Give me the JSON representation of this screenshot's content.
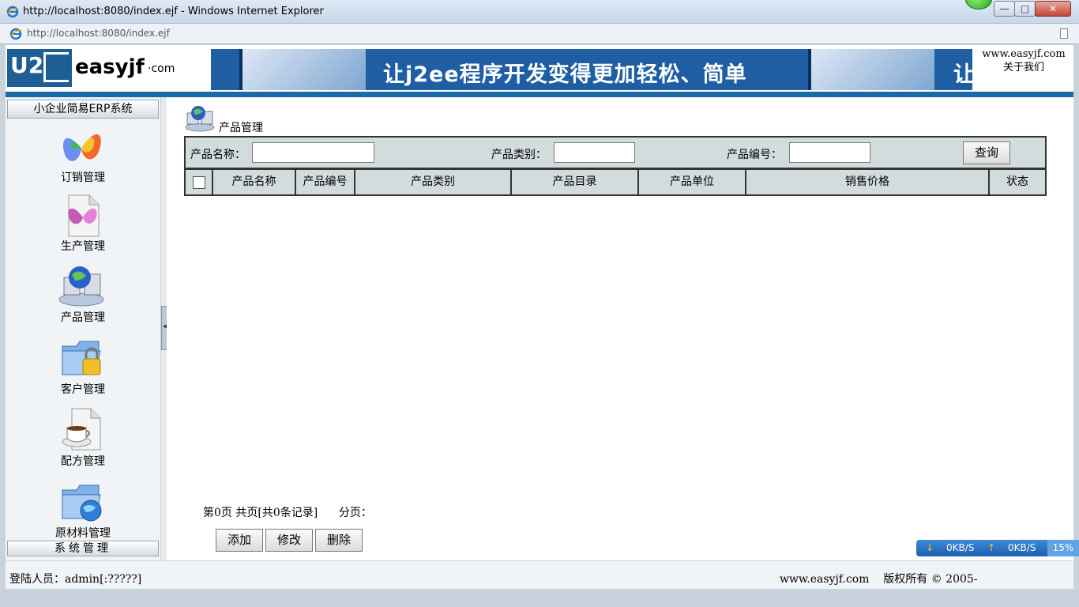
{
  "window": {
    "title": "http://localhost:8080/index.ejf - Windows Internet Explorer",
    "address": "http://localhost:8080/index.ejf",
    "min_glyph": "—",
    "max_glyph": "□",
    "close_glyph": "✕"
  },
  "header": {
    "logo_mark": "U2",
    "logo_text": "easyjf",
    "logo_suffix": "·com",
    "banner_slogan": "让j2ee程序开发变得更加轻松、简单",
    "banner_slogan_repeat": "让",
    "site": "www.easyjf.com",
    "about": "关于我们"
  },
  "sidebar": {
    "title": "小企业简易ERP系统",
    "items": [
      {
        "label": "订销管理",
        "icon": "butterfly-icon"
      },
      {
        "label": "生产管理",
        "icon": "document-butterfly-icon"
      },
      {
        "label": "产品管理",
        "icon": "globe-computer-icon"
      },
      {
        "label": "客户管理",
        "icon": "folder-lock-icon"
      },
      {
        "label": "配方管理",
        "icon": "coffee-document-icon"
      },
      {
        "label": "原材料管理",
        "icon": "folder-globe-icon"
      }
    ],
    "bottom": "系统管理"
  },
  "content": {
    "breadcrumb": "产品管理",
    "search": {
      "name_label": "产品名称：",
      "name_value": "",
      "category_label": "产品类别：",
      "category_value": "",
      "code_label": "产品编号：",
      "code_value": "",
      "query_button": "查询"
    },
    "table": {
      "columns": [
        "产品名称",
        "产品编号",
        "产品类别",
        "产品目录",
        "产品单位",
        "销售价格",
        "状态"
      ]
    },
    "pager": "第0页 共页[共0条记录]      分页：",
    "buttons": {
      "add": "添加",
      "edit": "修改",
      "delete": "删除"
    }
  },
  "footer": {
    "user": "登陆人员：admin[:?????]",
    "copyright": "www.easyjf.com    版权所有 © 2005-"
  },
  "netmon": {
    "down": "0KB/S",
    "up": "0KB/S",
    "percent": "15%"
  }
}
